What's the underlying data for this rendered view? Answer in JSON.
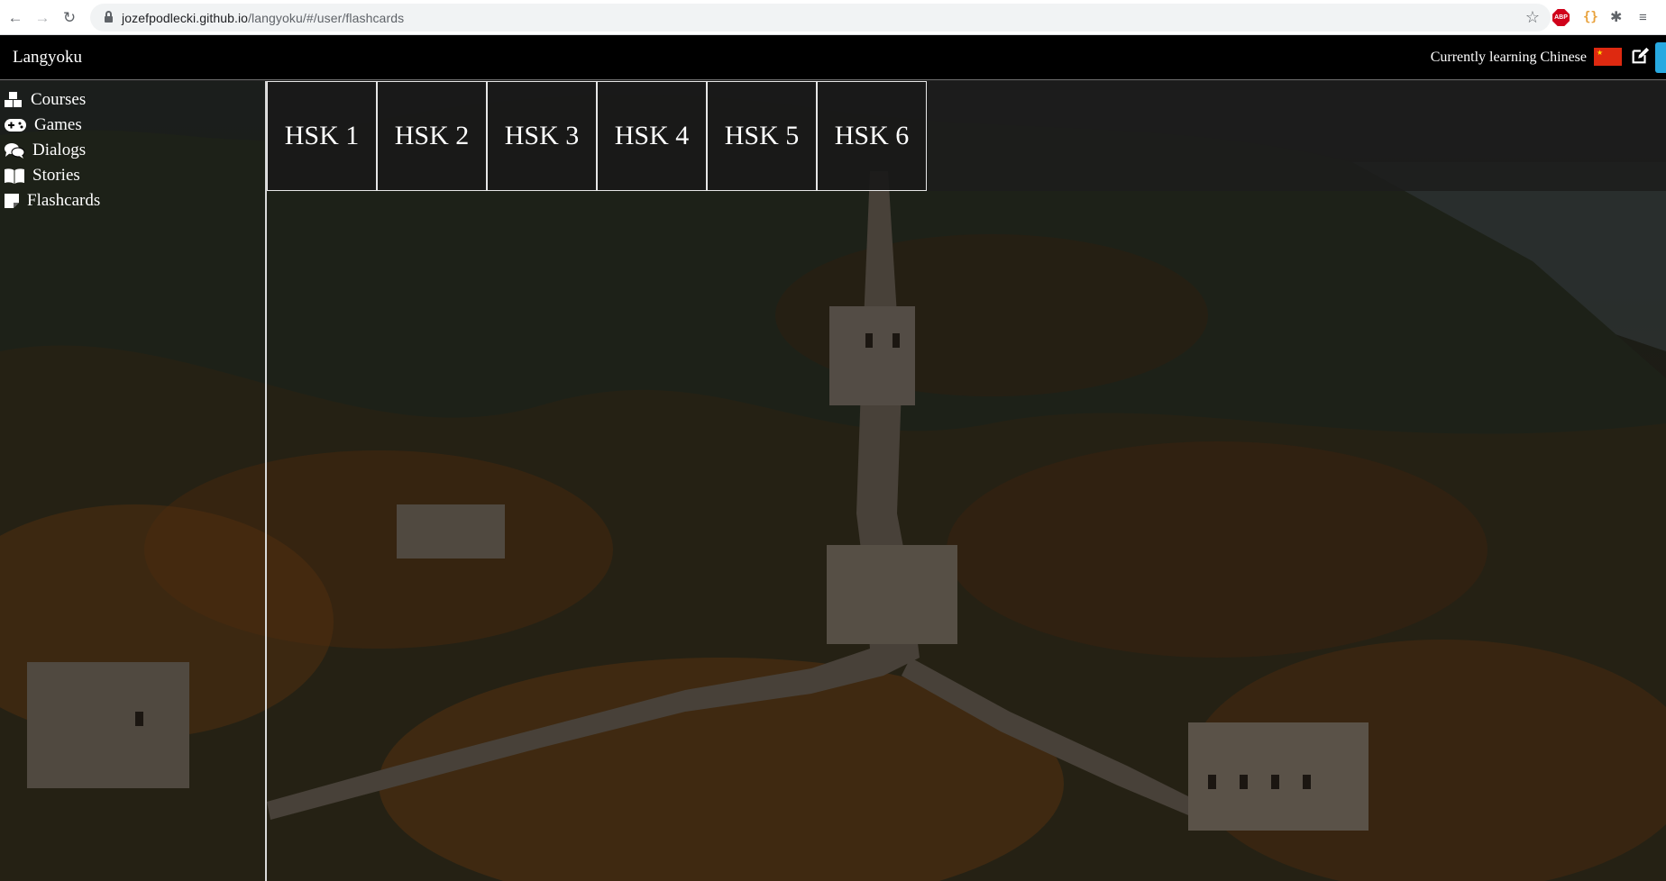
{
  "browser": {
    "url_host": "jozefpodlecki.github.io",
    "url_path": "/langyoku/#/user/flashcards",
    "icons": [
      "back-icon",
      "forward-icon",
      "reload-icon",
      "lock-icon",
      "star-icon",
      "adblock-icon",
      "braces-icon",
      "puzzle-icon",
      "reading-list-icon"
    ],
    "extensions": {
      "abp_label": "ABP",
      "braces_label": "{}"
    }
  },
  "header": {
    "brand": "Langyoku",
    "learning_text": "Currently learning Chinese",
    "flag_icon": "china-flag-icon",
    "edit_icon": "edit-icon"
  },
  "sidebar": {
    "items": [
      {
        "label": "Courses",
        "icon": "cubes-icon"
      },
      {
        "label": "Games",
        "icon": "gamepad-icon"
      },
      {
        "label": "Dialogs",
        "icon": "comments-icon"
      },
      {
        "label": "Stories",
        "icon": "book-open-icon"
      },
      {
        "label": "Flashcards",
        "icon": "sticky-note-icon"
      }
    ]
  },
  "tabs": [
    {
      "label": "HSK 1"
    },
    {
      "label": "HSK 2"
    },
    {
      "label": "HSK 3"
    },
    {
      "label": "HSK 4"
    },
    {
      "label": "HSK 5"
    },
    {
      "label": "HSK 6"
    }
  ],
  "colors": {
    "header_bg": "#000000",
    "text": "#ffffff",
    "tab_border": "#e6e6e6",
    "flag_red": "#de2910",
    "flag_star": "#ffde00",
    "accent": "#27a9e1"
  }
}
